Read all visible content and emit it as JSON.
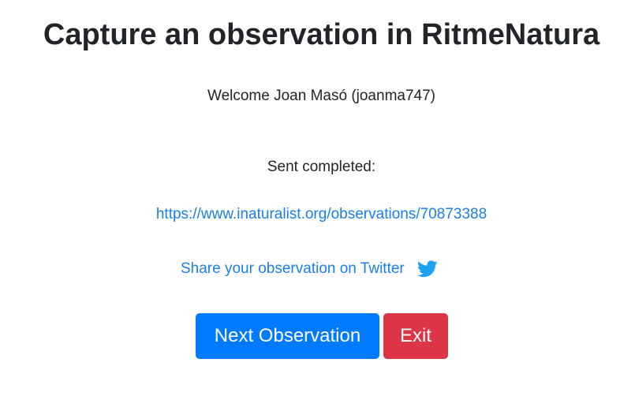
{
  "header": {
    "title": "Capture an observation in RitmeNatura"
  },
  "main": {
    "welcome_text": "Welcome Joan Masó (joanma747)",
    "sent_label": "Sent completed:",
    "observation_link": "https://www.inaturalist.org/observations/70873388",
    "share_text": "Share your observation on Twitter",
    "share_icon": "twitter-icon"
  },
  "actions": {
    "next_label": "Next Observation",
    "exit_label": "Exit"
  },
  "colors": {
    "primary": "#007bff",
    "danger": "#dc3545",
    "link": "#1a7fe6",
    "twitter": "#1da1f2"
  }
}
